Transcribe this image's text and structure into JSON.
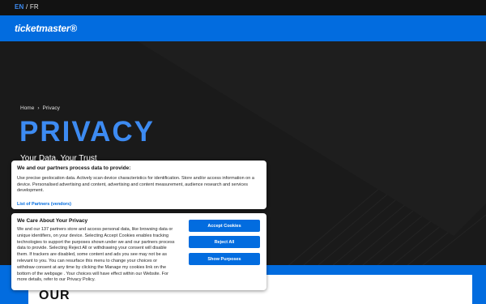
{
  "language": {
    "active": "EN",
    "separator": "/",
    "other": "FR"
  },
  "brand": {
    "logo_text": "ticketmaster®"
  },
  "breadcrumb": {
    "home": "Home",
    "separator": "›",
    "current": "Privacy"
  },
  "hero": {
    "title": "PRIVACY",
    "tagline": "Your Data. Your Trust",
    "next_heading": "OUR"
  },
  "purposes_notice": {
    "heading": "We and our partners process data to provide:",
    "body": "Use precise geolocation data. Actively scan device characteristics for identification. Store and/or access information on a device. Personalised advertising and content, advertising and content measurement, audience research and services development.",
    "link": "List of Partners (vendors)"
  },
  "consent_notice": {
    "heading": "We Care About Your Privacy",
    "body": "We and our 137 partners store and access personal data, like browsing data or unique identifiers, on your device. Selecting Accept Cookies enables tracking technologies to support the purposes shown under we and our partners process data to provide. Selecting Reject All or withdrawing your consent will disable them. If trackers are disabled, some content and ads you see may not be as relevant to you. You can resurface this menu to change your choices or withdraw consent at any time by clicking the Manage my cookies link on the bottom of the webpage . Your choices will have effect within our Website. For more details, refer to our Privacy Policy.",
    "accept_label": "Accept Cookies",
    "reject_label": "Reject All",
    "show_purposes_label": "Show Purposes"
  },
  "colors": {
    "brand_blue": "#026cdf",
    "accent_blue": "#3d8bf2",
    "background": "#121212"
  }
}
